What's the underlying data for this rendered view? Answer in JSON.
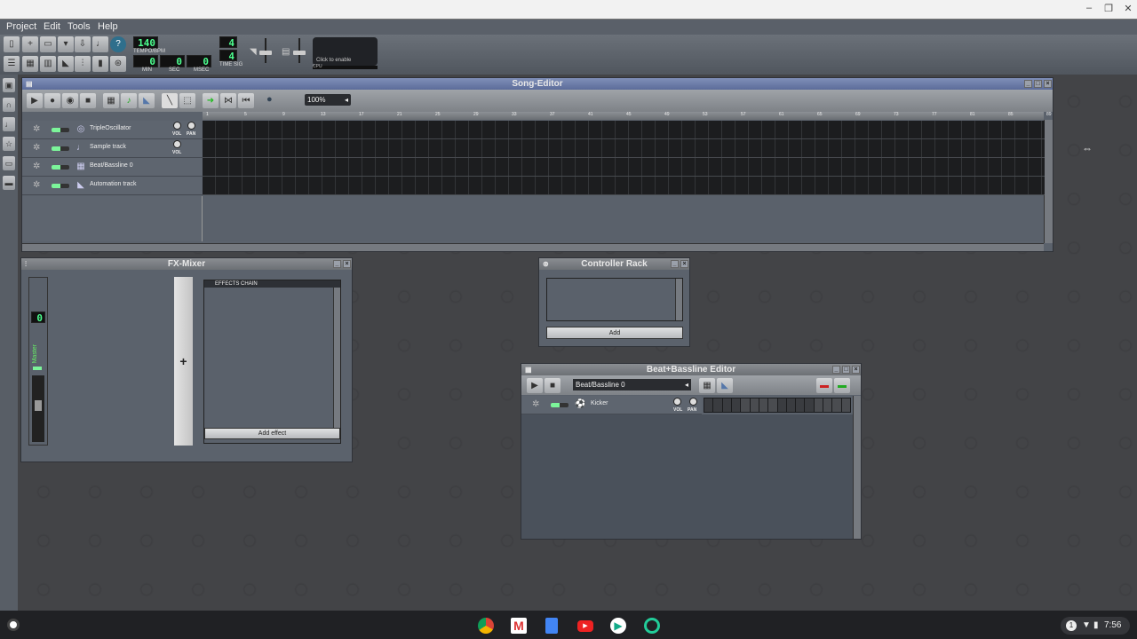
{
  "window_controls": {
    "minimize": "–",
    "restore": "❐",
    "close": "✕"
  },
  "menu": [
    "Project",
    "Edit",
    "Tools",
    "Help"
  ],
  "toolbar": {
    "tempo": "140",
    "tempo_label": "TEMPO/BPM",
    "time_min": "0",
    "time_sec": "0",
    "time_msec": "0",
    "min_label": "MIN",
    "sec_label": "SEC",
    "msec_label": "MSEC",
    "timesig_num": "4",
    "timesig_den": "4",
    "timesig_label": "TIME SIG",
    "cpu_text": "Click to enable",
    "cpu_label": "CPU"
  },
  "song_editor": {
    "title": "Song-Editor",
    "zoom": "100%",
    "ruler": [
      "1",
      "5",
      "9",
      "13",
      "17",
      "21",
      "25",
      "29",
      "33",
      "37",
      "41",
      "45",
      "49",
      "53",
      "57",
      "61",
      "65",
      "69",
      "73",
      "77",
      "81",
      "85",
      "89"
    ],
    "tracks": [
      {
        "name": "TripleOscillator",
        "icon": "◎",
        "knobs": [
          "VOL",
          "PAN"
        ]
      },
      {
        "name": "Sample track",
        "icon": "♩",
        "knobs": [
          "VOL"
        ]
      },
      {
        "name": "Beat/Bassline 0",
        "icon": "▦",
        "knobs": []
      },
      {
        "name": "Automation track",
        "icon": "◣",
        "knobs": []
      }
    ]
  },
  "fx_mixer": {
    "title": "FX-Mixer",
    "channel_num": "0",
    "channel_name": "Master",
    "add_channel": "+",
    "effects_chain": "EFFECTS CHAIN",
    "add_effect": "Add effect"
  },
  "controller_rack": {
    "title": "Controller Rack",
    "add": "Add"
  },
  "bb_editor": {
    "title": "Beat+Bassline Editor",
    "selected": "Beat/Bassline 0",
    "track": {
      "name": "Kicker",
      "knobs": [
        "VOL",
        "PAN"
      ]
    }
  },
  "taskbar": {
    "apps": [
      "chrome",
      "gmail",
      "docs",
      "youtube",
      "play-store",
      "lmms"
    ],
    "notif_count": "1",
    "time": "7:56"
  }
}
